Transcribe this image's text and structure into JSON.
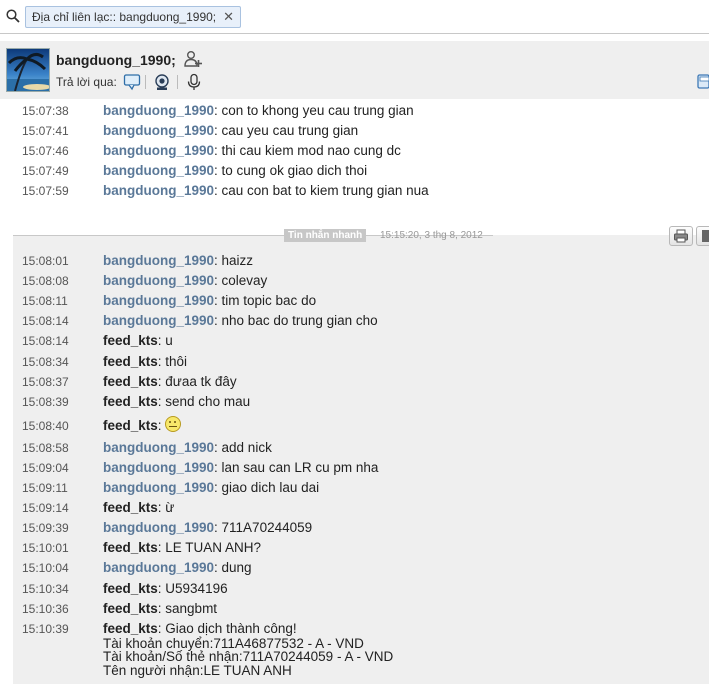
{
  "search": {
    "chip_label": "Địa chỉ liên lạc:: bangduong_1990;",
    "close_glyph": "✕"
  },
  "header": {
    "contact_name": "bangduong_1990;",
    "reply_via_label": "Trả lời qua:",
    "icons": [
      "add-contact-icon",
      "chat-bubble-icon",
      "webcam-icon",
      "microphone-icon"
    ]
  },
  "colors": {
    "sender_bangduong": "#5a7898",
    "sender_feed": "#222222",
    "history_bg": "#efefef",
    "divider_label_bg": "#c7c7c7"
  },
  "history_messages": [
    {
      "time": "15:07:38",
      "sender": "bangduong_1990",
      "text": ": con to khong yeu cau trung gian"
    },
    {
      "time": "15:07:41",
      "sender": "bangduong_1990",
      "text": ": cau yeu cau trung gian"
    },
    {
      "time": "15:07:46",
      "sender": "bangduong_1990",
      "text": ": thi cau kiem mod nao cung dc"
    },
    {
      "time": "15:07:49",
      "sender": "bangduong_1990",
      "text": ": to cung ok giao dich thoi"
    },
    {
      "time": "15:07:59",
      "sender": "bangduong_1990",
      "text": ": cau con bat to kiem trung gian nua"
    }
  ],
  "divider": {
    "label": "Tin nhắn nhanh",
    "timestamp": "15:15:20, 3 thg 8, 2012"
  },
  "session_messages": [
    {
      "time": "15:08:01",
      "sender": "bangduong_1990",
      "text": ": haizz"
    },
    {
      "time": "15:08:08",
      "sender": "bangduong_1990",
      "text": ": colevay"
    },
    {
      "time": "15:08:11",
      "sender": "bangduong_1990",
      "text": ": tim topic bac do"
    },
    {
      "time": "15:08:14",
      "sender": "bangduong_1990",
      "text": ": nho bac do trung gian cho"
    },
    {
      "time": "15:08:14",
      "sender": "feed_kts",
      "text": ": u"
    },
    {
      "time": "15:08:34",
      "sender": "feed_kts",
      "text": ": thôi"
    },
    {
      "time": "15:08:37",
      "sender": "feed_kts",
      "text": ": đưaa tk đây"
    },
    {
      "time": "15:08:39",
      "sender": "feed_kts",
      "text": ": send cho mau"
    },
    {
      "time": "15:08:40",
      "sender": "feed_kts",
      "text": ": ",
      "emoji": "neutral-face-emoji"
    },
    {
      "time": "15:08:58",
      "sender": "bangduong_1990",
      "text": ": add nick"
    },
    {
      "time": "15:09:04",
      "sender": "bangduong_1990",
      "text": ": lan sau can LR cu pm nha"
    },
    {
      "time": "15:09:11",
      "sender": "bangduong_1990",
      "text": ": giao dich lau dai"
    },
    {
      "time": "15:09:14",
      "sender": "feed_kts",
      "text": ": ừ"
    },
    {
      "time": "15:09:39",
      "sender": "bangduong_1990",
      "text": ": 711A70244059"
    },
    {
      "time": "15:10:01",
      "sender": "feed_kts",
      "text": ": LE TUAN ANH?"
    },
    {
      "time": "15:10:04",
      "sender": "bangduong_1990",
      "text": ": dung"
    },
    {
      "time": "15:10:34",
      "sender": "feed_kts",
      "text": ": U5934196"
    },
    {
      "time": "15:10:36",
      "sender": "feed_kts",
      "text": ": sangbmt"
    },
    {
      "time": "15:10:39",
      "sender": "feed_kts",
      "text": ": Giao dịch thành công!",
      "extra_lines": [
        "Tài khoản chuyển:711A46877532 - A - VND",
        "Tài khoản/Số thẻ nhận:711A70244059 - A - VND",
        "Tên người nhận:LE TUAN ANH"
      ]
    }
  ]
}
